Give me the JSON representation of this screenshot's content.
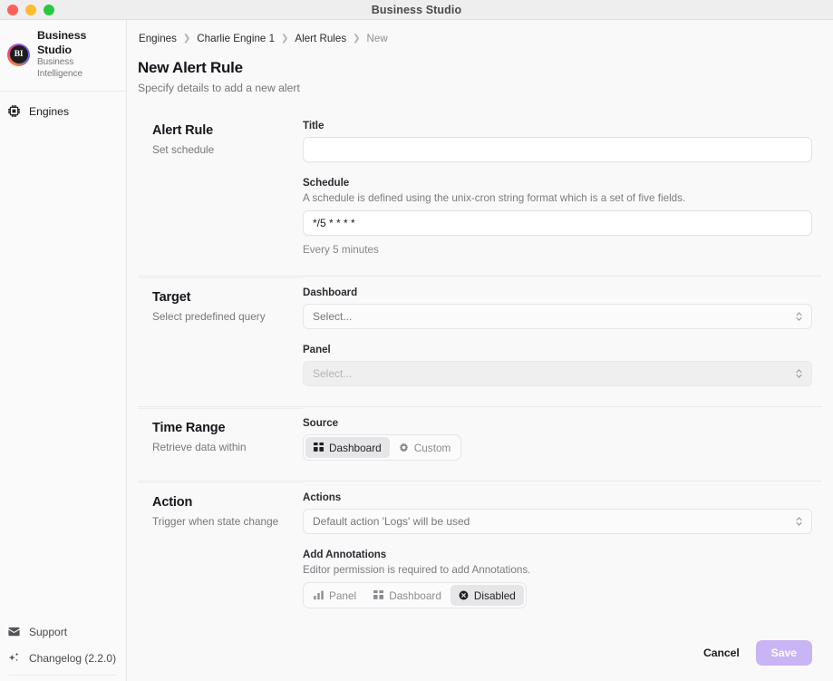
{
  "window": {
    "title": "Business Studio",
    "traffic_lights": [
      "close",
      "minimize",
      "zoom"
    ]
  },
  "sidebar": {
    "brand": {
      "logo_text": "BI",
      "title": "Business Studio",
      "subtitle": "Business Intelligence"
    },
    "items": [
      {
        "label": "Engines",
        "icon": "cpu-chip-icon"
      }
    ],
    "bottom_items": [
      {
        "label": "Support",
        "icon": "envelope-icon"
      },
      {
        "label": "Changelog (2.2.0)",
        "icon": "sparkles-icon"
      }
    ]
  },
  "breadcrumb": [
    {
      "label": "Engines",
      "current": false
    },
    {
      "label": "Charlie Engine 1",
      "current": false
    },
    {
      "label": "Alert Rules",
      "current": false
    },
    {
      "label": "New",
      "current": true
    }
  ],
  "page": {
    "title": "New Alert Rule",
    "subtitle": "Specify details to add a new alert"
  },
  "sections": {
    "alert_rule": {
      "title": "Alert Rule",
      "desc": "Set schedule",
      "title_field": {
        "label": "Title",
        "value": "",
        "placeholder": ""
      },
      "schedule_field": {
        "label": "Schedule",
        "hint": "A schedule is defined using the unix-cron string format which is a set of five fields.",
        "value": "*/5 * * * *",
        "help": "Every 5 minutes"
      }
    },
    "target": {
      "title": "Target",
      "desc": "Select predefined query",
      "dashboard_field": {
        "label": "Dashboard",
        "value": "Select...",
        "disabled": false
      },
      "panel_field": {
        "label": "Panel",
        "value": "Select...",
        "disabled": true
      }
    },
    "time_range": {
      "title": "Time Range",
      "desc": "Retrieve data within",
      "source_field": {
        "label": "Source",
        "options": [
          {
            "label": "Dashboard",
            "icon": "grid-squares-icon",
            "active": true
          },
          {
            "label": "Custom",
            "icon": "gear-icon",
            "active": false
          }
        ]
      }
    },
    "action": {
      "title": "Action",
      "desc": "Trigger when state change",
      "actions_field": {
        "label": "Actions",
        "value": "Default action 'Logs' will be used"
      },
      "annotations_field": {
        "label": "Add Annotations",
        "hint": "Editor permission is required to add Annotations.",
        "options": [
          {
            "label": "Panel",
            "icon": "bar-chart-icon",
            "active": false
          },
          {
            "label": "Dashboard",
            "icon": "grid-squares-icon",
            "active": false
          },
          {
            "label": "Disabled",
            "icon": "circle-x-icon",
            "active": true
          }
        ]
      }
    }
  },
  "footer": {
    "cancel_label": "Cancel",
    "save_label": "Save"
  },
  "colors": {
    "accent": "#c9b4f5",
    "sidebar_bg": "#fafafa",
    "main_bg": "#f9f9f9"
  }
}
